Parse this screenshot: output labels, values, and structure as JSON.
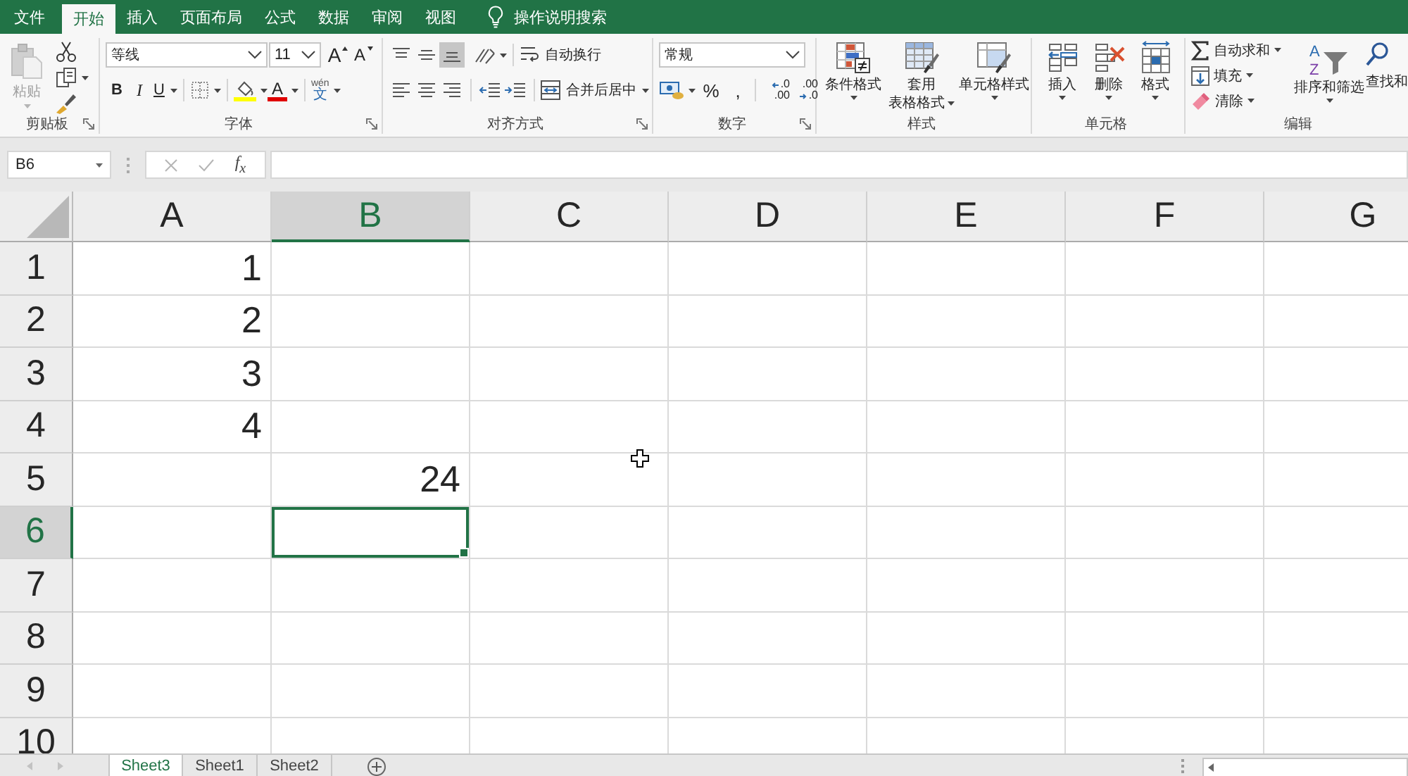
{
  "ribbon_tabs": [
    {
      "label": "文件",
      "selected": false
    },
    {
      "label": "开始",
      "selected": true
    },
    {
      "label": "插入",
      "selected": false
    },
    {
      "label": "页面布局",
      "selected": false
    },
    {
      "label": "公式",
      "selected": false
    },
    {
      "label": "数据",
      "selected": false
    },
    {
      "label": "审阅",
      "selected": false
    },
    {
      "label": "视图",
      "selected": false
    }
  ],
  "tell_me": {
    "label": "操作说明搜索"
  },
  "clipboard": {
    "label": "剪贴板",
    "paste": {
      "label": "粘贴",
      "disabled": true
    }
  },
  "font": {
    "label": "字体",
    "font_name": "等线",
    "font_size": "11",
    "grow_label": "A",
    "shrink_label": "A",
    "bold_label": "B",
    "italic_label": "I",
    "underline_label": "U",
    "font_color_label": "A",
    "phonetic_top": "wén",
    "phonetic_bottom": "文"
  },
  "alignment": {
    "label": "对齐方式",
    "vertical": [
      {
        "kind": "top",
        "selected": false
      },
      {
        "kind": "middle",
        "selected": false
      },
      {
        "kind": "bottom",
        "selected": true
      }
    ],
    "horizontal": [
      {
        "kind": "left",
        "selected": false
      },
      {
        "kind": "center",
        "selected": false
      },
      {
        "kind": "right",
        "selected": false
      }
    ],
    "wrap_text": "自动换行",
    "merge_center": "合并后居中"
  },
  "number": {
    "label": "数字",
    "format": "常规",
    "percent": "%",
    "comma": ",",
    "increase_decimal": {
      "top": ".0",
      "bottom": ".00"
    },
    "decrease_decimal": {
      "top": ".00",
      "bottom": ".0"
    }
  },
  "styles": {
    "label": "样式",
    "buttons": [
      {
        "kind": "conditional_format",
        "lines": [
          "条件格式"
        ]
      },
      {
        "kind": "table_format",
        "lines": [
          "套用",
          "表格格式"
        ]
      },
      {
        "kind": "cell_styles",
        "lines": [
          "单元格样式"
        ]
      }
    ]
  },
  "cells": {
    "label": "单元格",
    "buttons": [
      {
        "kind": "insert",
        "label": "插入"
      },
      {
        "kind": "delete",
        "label": "删除"
      },
      {
        "kind": "format",
        "label": "格式"
      }
    ]
  },
  "editing": {
    "label": "编辑",
    "small": [
      {
        "kind": "autosum",
        "label": "自动求和"
      },
      {
        "kind": "fill",
        "label": "填充"
      },
      {
        "kind": "clear",
        "label": "清除"
      }
    ],
    "sort_filter": {
      "label": "排序和筛选",
      "letters": [
        "A",
        "Z"
      ]
    },
    "find": {
      "label": "查找和"
    }
  },
  "formula_bar": {
    "name_box": "B6",
    "function_label": "f$_{x}$"
  },
  "sheet": {
    "columns": [
      {
        "label": "A",
        "selected": false
      },
      {
        "label": "B",
        "selected": true
      },
      {
        "label": "C",
        "selected": false
      },
      {
        "label": "D",
        "selected": false
      },
      {
        "label": "E",
        "selected": false
      },
      {
        "label": "F",
        "selected": false
      },
      {
        "label": "G",
        "selected": false
      }
    ],
    "rows": [
      {
        "label": "1",
        "selected": false,
        "cells": [
          {
            "text": "1",
            "selected": false
          },
          {
            "selected": false
          },
          {
            "selected": false
          },
          {
            "selected": false
          },
          {
            "selected": false
          },
          {
            "selected": false
          },
          {
            "selected": false
          }
        ]
      },
      {
        "label": "2",
        "selected": false,
        "cells": [
          {
            "text": "2",
            "selected": false
          },
          {
            "selected": false
          },
          {
            "selected": false
          },
          {
            "selected": false
          },
          {
            "selected": false
          },
          {
            "selected": false
          },
          {
            "selected": false
          }
        ]
      },
      {
        "label": "3",
        "selected": false,
        "cells": [
          {
            "text": "3",
            "selected": false
          },
          {
            "selected": false
          },
          {
            "selected": false
          },
          {
            "selected": false
          },
          {
            "selected": false
          },
          {
            "selected": false
          },
          {
            "selected": false
          }
        ]
      },
      {
        "label": "4",
        "selected": false,
        "cells": [
          {
            "text": "4",
            "selected": false
          },
          {
            "selected": false
          },
          {
            "selected": false
          },
          {
            "selected": false
          },
          {
            "selected": false
          },
          {
            "selected": false
          },
          {
            "selected": false
          }
        ]
      },
      {
        "label": "5",
        "selected": false,
        "cells": [
          {
            "selected": false
          },
          {
            "text": "24",
            "selected": false
          },
          {
            "selected": false
          },
          {
            "selected": false
          },
          {
            "selected": false
          },
          {
            "selected": false
          },
          {
            "selected": false
          }
        ]
      },
      {
        "label": "6",
        "selected": true,
        "cells": [
          {
            "selected": false
          },
          {
            "selected": true
          },
          {
            "selected": false
          },
          {
            "selected": false
          },
          {
            "selected": false
          },
          {
            "selected": false
          },
          {
            "selected": false
          }
        ]
      },
      {
        "label": "7",
        "selected": false,
        "cells": [
          {
            "selected": false
          },
          {
            "selected": false
          },
          {
            "selected": false
          },
          {
            "selected": false
          },
          {
            "selected": false
          },
          {
            "selected": false
          },
          {
            "selected": false
          }
        ]
      },
      {
        "label": "8",
        "selected": false,
        "cells": [
          {
            "selected": false
          },
          {
            "selected": false
          },
          {
            "selected": false
          },
          {
            "selected": false
          },
          {
            "selected": false
          },
          {
            "selected": false
          },
          {
            "selected": false
          }
        ]
      },
      {
        "label": "9",
        "selected": false,
        "cells": [
          {
            "selected": false
          },
          {
            "selected": false
          },
          {
            "selected": false
          },
          {
            "selected": false
          },
          {
            "selected": false
          },
          {
            "selected": false
          },
          {
            "selected": false
          }
        ]
      },
      {
        "label": "10",
        "selected": false,
        "cells": [
          {
            "selected": false
          },
          {
            "selected": false
          },
          {
            "selected": false
          },
          {
            "selected": false
          },
          {
            "selected": false
          },
          {
            "selected": false
          },
          {
            "selected": false
          }
        ]
      }
    ]
  },
  "sheet_tabs": [
    {
      "label": "Sheet3",
      "selected": true
    },
    {
      "label": "Sheet1",
      "selected": false
    },
    {
      "label": "Sheet2",
      "selected": false
    }
  ]
}
